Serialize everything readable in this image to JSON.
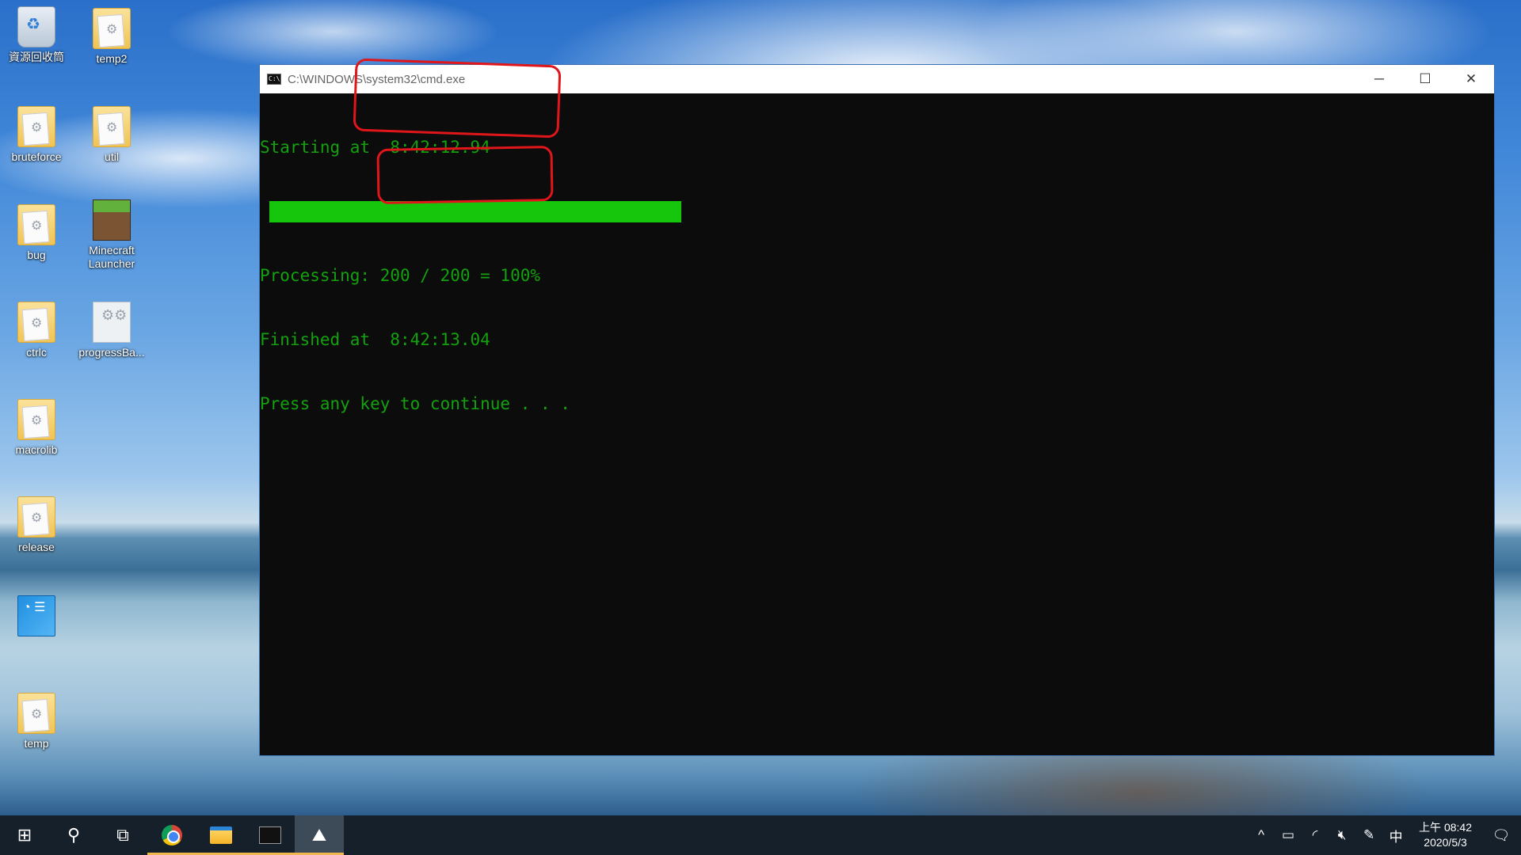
{
  "desktop": {
    "icons": [
      {
        "label": "資源回收筒"
      },
      {
        "label": "temp2"
      },
      {
        "label": "bruteforce"
      },
      {
        "label": "util"
      },
      {
        "label": "bug"
      },
      {
        "label": "Minecraft Launcher"
      },
      {
        "label": "ctrlc"
      },
      {
        "label": "progressBa..."
      },
      {
        "label": "macrolib"
      },
      {
        "label": "release"
      },
      {
        "label": ""
      },
      {
        "label": "temp"
      }
    ]
  },
  "cmd_window": {
    "title": "C:\\WINDOWS\\system32\\cmd.exe",
    "lines": {
      "start": "Starting at  8:42:12.94",
      "progress_value": 1.0,
      "processing": "Processing: 200 / 200 = 100%",
      "finished": "Finished at  8:42:13.04",
      "prompt": "Press any key to continue . . ."
    },
    "buttons": {
      "minimize": "─",
      "maximize": "☐",
      "close": "✕"
    }
  },
  "taskbar": {
    "apps": [
      {
        "name": "start-icon"
      },
      {
        "name": "search-icon"
      },
      {
        "name": "task-view-icon"
      },
      {
        "name": "chrome-icon"
      },
      {
        "name": "file-explorer-icon"
      },
      {
        "name": "cmd-icon"
      },
      {
        "name": "app-icon"
      }
    ],
    "tray": {
      "chevron": "^",
      "ime": "中",
      "time": "上午 08:42",
      "date": "2020/5/3"
    }
  },
  "colors": {
    "console_text": "#13a10e",
    "progress_bar": "#16c60c",
    "annotation": "#e0161a",
    "taskbar": "#16202a"
  }
}
